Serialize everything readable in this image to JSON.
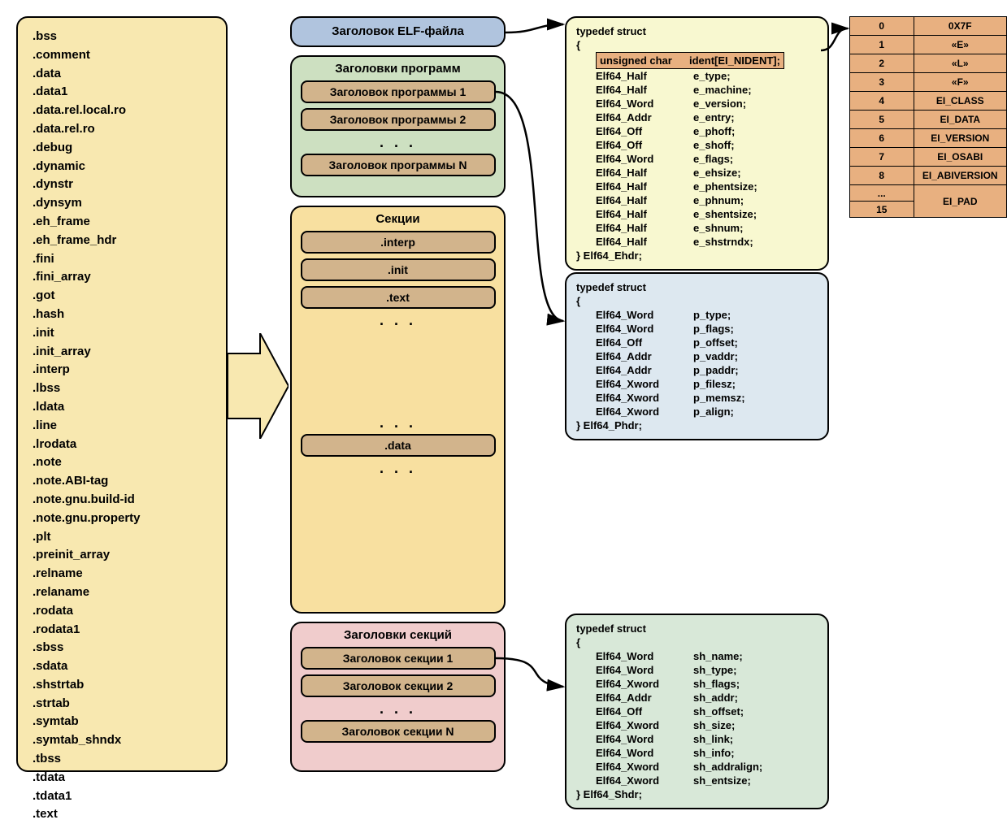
{
  "sections_list": [
    ".bss",
    ".comment",
    ".data",
    ".data1",
    ".data.rel.local.ro",
    ".data.rel.ro",
    ".debug",
    ".dynamic",
    ".dynstr",
    ".dynsym",
    ".eh_frame",
    ".eh_frame_hdr",
    ".fini",
    ".fini_array",
    ".got",
    ".hash",
    ".init",
    ".init_array",
    ".interp",
    ".lbss",
    ".ldata",
    ".line",
    ".lrodata",
    ".note",
    ".note.ABI-tag",
    ".note.gnu.build-id",
    ".note.gnu.property",
    ".plt",
    ".preinit_array",
    ".relname",
    ".relaname",
    ".rodata",
    ".rodata1",
    ".sbss",
    ".sdata",
    ".shstrtab",
    ".strtab",
    ".symtab",
    ".symtab_shndx",
    ".tbss",
    ".tdata",
    ".tdata1",
    ".text"
  ],
  "file_layout": {
    "elf_header": "Заголовок ELF-файла",
    "prog_headers_title": "Заголовки программ",
    "prog_headers": [
      "Заголовок программы 1",
      "Заголовок программы 2",
      "Заголовок программы N"
    ],
    "sections_title": "Секции",
    "sections": [
      ".interp",
      ".init",
      ".text",
      ".data"
    ],
    "section_headers_title": "Заголовки секций",
    "section_headers": [
      "Заголовок секции 1",
      "Заголовок секции 2",
      "Заголовок секции N"
    ],
    "ellipsis": ". . ."
  },
  "ehdr": {
    "open": "typedef struct",
    "brace_open": "{",
    "highlight": {
      "type": "unsigned char",
      "name": "ident[EI_NIDENT];"
    },
    "fields": [
      {
        "type": "Elf64_Half",
        "name": "e_type;"
      },
      {
        "type": "Elf64_Half",
        "name": "e_machine;"
      },
      {
        "type": "Elf64_Word",
        "name": "e_version;"
      },
      {
        "type": "Elf64_Addr",
        "name": "e_entry;"
      },
      {
        "type": "Elf64_Off",
        "name": "e_phoff;"
      },
      {
        "type": "Elf64_Off",
        "name": "e_shoff;"
      },
      {
        "type": "Elf64_Word",
        "name": "e_flags;"
      },
      {
        "type": "Elf64_Half",
        "name": "e_ehsize;"
      },
      {
        "type": "Elf64_Half",
        "name": "e_phentsize;"
      },
      {
        "type": "Elf64_Half",
        "name": "e_phnum;"
      },
      {
        "type": "Elf64_Half",
        "name": "e_shentsize;"
      },
      {
        "type": "Elf64_Half",
        "name": "e_shnum;"
      },
      {
        "type": "Elf64_Half",
        "name": "e_shstrndx;"
      }
    ],
    "close": "} Elf64_Ehdr;"
  },
  "phdr": {
    "open": "typedef struct",
    "brace_open": "{",
    "fields": [
      {
        "type": "Elf64_Word",
        "name": "p_type;"
      },
      {
        "type": "Elf64_Word",
        "name": "p_flags;"
      },
      {
        "type": "Elf64_Off",
        "name": "p_offset;"
      },
      {
        "type": "Elf64_Addr",
        "name": "p_vaddr;"
      },
      {
        "type": "Elf64_Addr",
        "name": "p_paddr;"
      },
      {
        "type": "Elf64_Xword",
        "name": "p_filesz;"
      },
      {
        "type": "Elf64_Xword",
        "name": "p_memsz;"
      },
      {
        "type": "Elf64_Xword",
        "name": "p_align;"
      }
    ],
    "close": "} Elf64_Phdr;"
  },
  "shdr": {
    "open": "typedef struct",
    "brace_open": "{",
    "fields": [
      {
        "type": "Elf64_Word",
        "name": "sh_name;"
      },
      {
        "type": "Elf64_Word",
        "name": "sh_type;"
      },
      {
        "type": "Elf64_Xword",
        "name": "sh_flags;"
      },
      {
        "type": "Elf64_Addr",
        "name": "sh_addr;"
      },
      {
        "type": "Elf64_Off",
        "name": "sh_offset;"
      },
      {
        "type": "Elf64_Xword",
        "name": "sh_size;"
      },
      {
        "type": "Elf64_Word",
        "name": "sh_link;"
      },
      {
        "type": "Elf64_Word",
        "name": "sh_info;"
      },
      {
        "type": "Elf64_Xword",
        "name": "sh_addralign;"
      },
      {
        "type": "Elf64_Xword",
        "name": "sh_entsize;"
      }
    ],
    "close": "} Elf64_Shdr;"
  },
  "ident_table": [
    {
      "idx": "0",
      "val": "0X7F"
    },
    {
      "idx": "1",
      "val": "«E»"
    },
    {
      "idx": "2",
      "val": "«L»"
    },
    {
      "idx": "3",
      "val": "«F»"
    },
    {
      "idx": "4",
      "val": "EI_CLASS"
    },
    {
      "idx": "5",
      "val": "EI_DATA"
    },
    {
      "idx": "6",
      "val": "EI_VERSION"
    },
    {
      "idx": "7",
      "val": "EI_OSABI"
    },
    {
      "idx": "8",
      "val": "EI_ABIVERSION"
    }
  ],
  "ident_pad": {
    "idx_top": "...",
    "idx_bot": "15",
    "val": "EI_PAD"
  }
}
